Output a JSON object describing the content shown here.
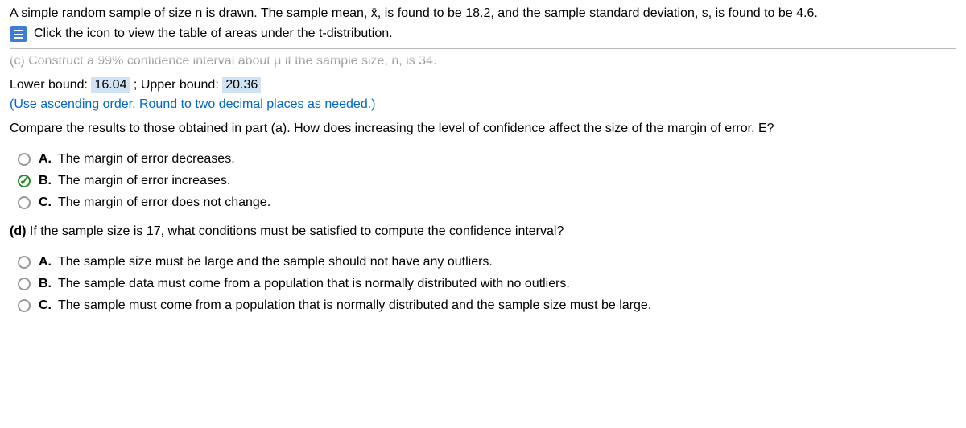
{
  "intro": {
    "text": "A simple random sample of size n is drawn. The sample mean, x̄, is found to be 18.2, and the sample standard deviation, s, is found to be 4.6."
  },
  "icon_row": {
    "text": "Click the icon to view the table of areas under the t-distribution."
  },
  "partC": {
    "faded": "(c) Construct a 99% confidence interval about μ if the sample size, n, is 34.",
    "lower_label": "Lower bound:",
    "lower_value": "16.04",
    "separator": "; Upper bound:",
    "upper_value": "20.36",
    "instruction": "(Use ascending order. Round to two decimal places as needed.)",
    "compare": "Compare the results to those obtained in part (a). How does increasing the level of confidence affect the size of the margin of error, E?",
    "options": [
      {
        "letter": "A.",
        "text": "The margin of error decreases."
      },
      {
        "letter": "B.",
        "text": "The margin of error increases."
      },
      {
        "letter": "C.",
        "text": "The margin of error does not change."
      }
    ]
  },
  "partD": {
    "label": "(d)",
    "text": "If the sample size is 17, what conditions must be satisfied to compute the confidence interval?",
    "options": [
      {
        "letter": "A.",
        "text": "The sample size must be large and the sample should not have any outliers."
      },
      {
        "letter": "B.",
        "text": "The sample data must come from a population that is normally distributed with no outliers."
      },
      {
        "letter": "C.",
        "text": "The sample must come from a population that is normally distributed and the sample size must be large."
      }
    ]
  }
}
